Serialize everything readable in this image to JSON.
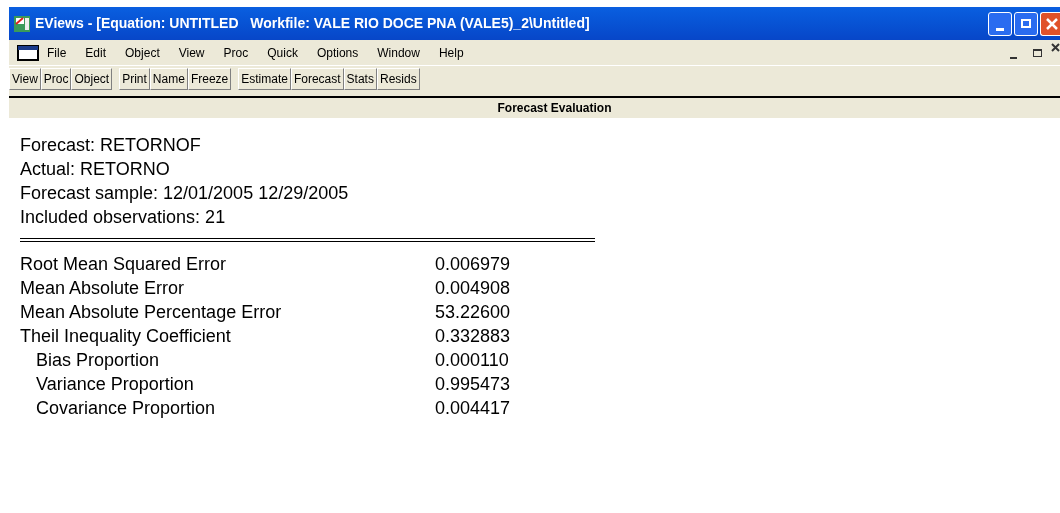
{
  "window": {
    "title": "EViews - [Equation: UNTITLED   Workfile: VALE RIO DOCE PNA (VALE5)_2\\Untitled]"
  },
  "menu": [
    "File",
    "Edit",
    "Object",
    "View",
    "Proc",
    "Quick",
    "Options",
    "Window",
    "Help"
  ],
  "toolbar": [
    [
      "View",
      "Proc",
      "Object"
    ],
    [
      "Print",
      "Name",
      "Freeze"
    ],
    [
      "Estimate",
      "Forecast",
      "Stats",
      "Resids"
    ]
  ],
  "view_title": "Forecast Evaluation",
  "header_lines": [
    "Forecast: RETORNOF",
    "Actual: RETORNO",
    "Forecast sample: 12/01/2005 12/29/2005",
    "Included observations: 21"
  ],
  "stats": [
    {
      "label": "Root Mean Squared Error",
      "value": "0.006979"
    },
    {
      "label": "Mean Absolute Error",
      "value": "0.004908"
    },
    {
      "label": "Mean Absolute Percentage Error",
      "value": "53.22600"
    },
    {
      "label": "Theil Inequality Coefficient",
      "value": "0.332883",
      "children": [
        {
          "label": "Bias Proportion",
          "value": "0.000110"
        },
        {
          "label": "Variance Proportion",
          "value": "0.995473"
        },
        {
          "label": "Covariance Proportion",
          "value": "0.004417"
        }
      ]
    }
  ]
}
